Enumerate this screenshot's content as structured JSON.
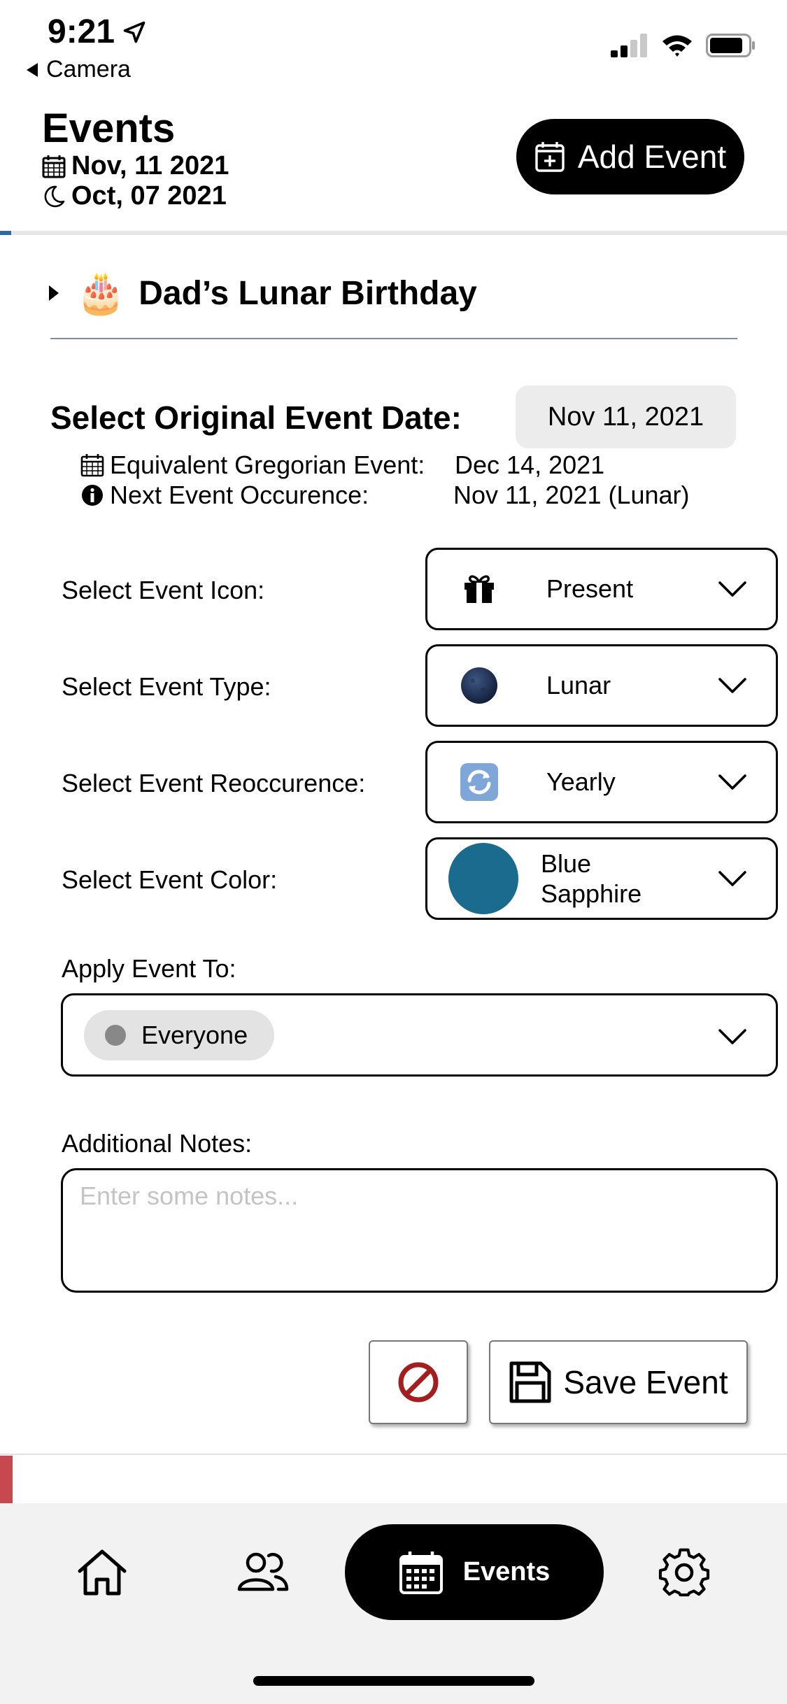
{
  "status_bar": {
    "time": "9:21",
    "back_label": "Camera"
  },
  "header": {
    "title": "Events",
    "gregorian_date": "Nov, 11 2021",
    "lunar_date": "Oct, 07 2021",
    "add_button_label": "Add Event"
  },
  "event": {
    "emoji": "🎂",
    "title": "Dad’s Lunar Birthday",
    "original_date_label": "Select Original Event Date:",
    "original_date_value": "Nov 11, 2021",
    "equivalent_label": "Equivalent Gregorian Event:",
    "equivalent_value": "Dec 14, 2021",
    "next_label": "Next Event Occurence:",
    "next_value": "Nov 11, 2021 (Lunar)"
  },
  "form": {
    "icon_label": "Select Event Icon:",
    "icon_value": "Present",
    "type_label": "Select Event Type:",
    "type_value": "Lunar",
    "recurrence_label": "Select Event Reoccurence:",
    "recurrence_value": "Yearly",
    "color_label": "Select Event Color:",
    "color_value_line1": "Blue",
    "color_value_line2": "Sapphire",
    "color_hex": "#1a6b8e",
    "apply_label": "Apply Event To:",
    "apply_value": "Everyone",
    "notes_label": "Additional Notes:",
    "notes_placeholder": "Enter some notes...",
    "save_label": "Save Event"
  },
  "tabbar": {
    "active_label": "Events",
    "icons": [
      "home-icon",
      "people-icon",
      "calendar-icon",
      "gear-icon"
    ]
  },
  "colors": {
    "accent_black": "#000000",
    "cancel_red": "#a31e1e",
    "divider_blue": "#2a6aa0",
    "mark_red": "#c8484f"
  }
}
